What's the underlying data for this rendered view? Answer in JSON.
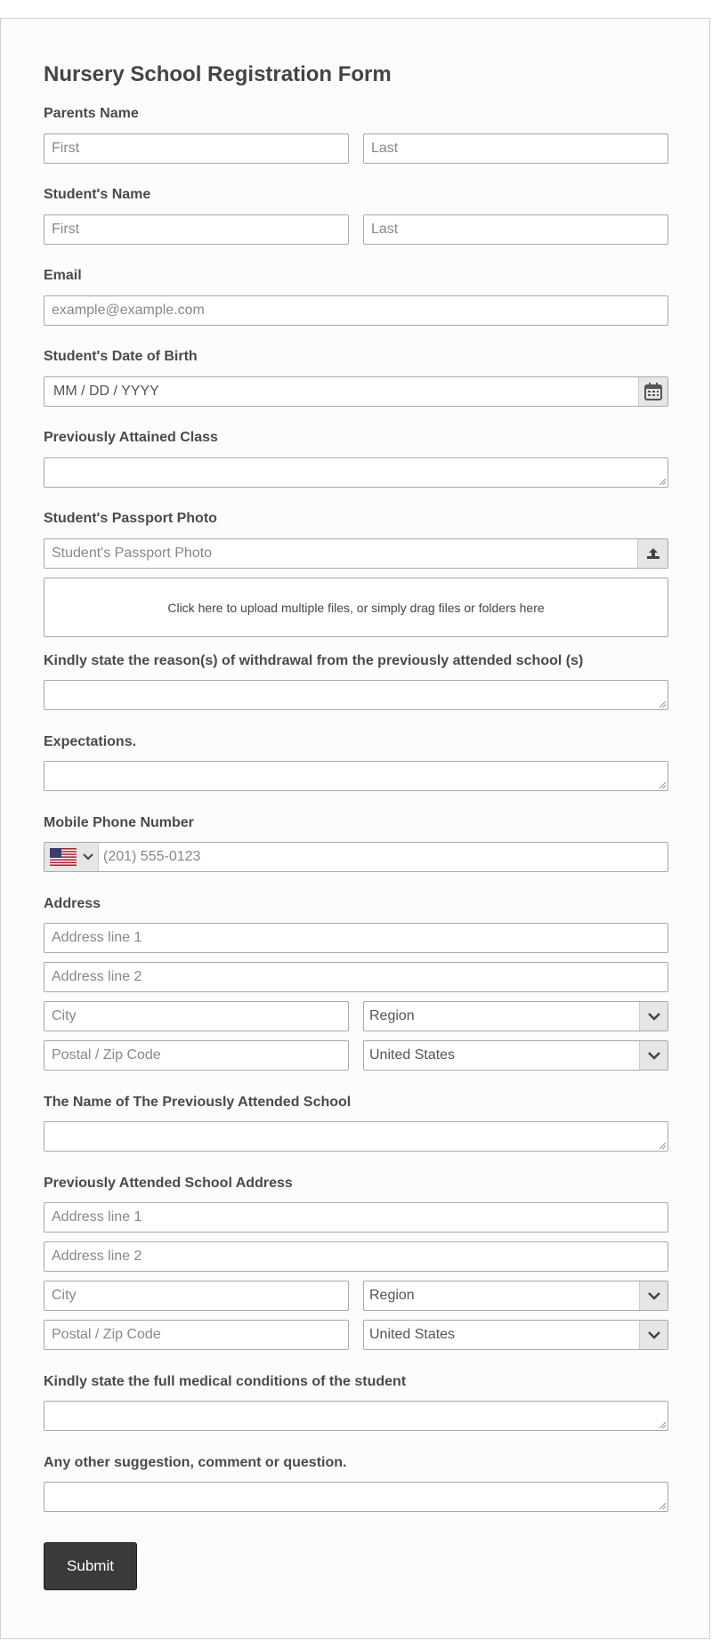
{
  "form": {
    "title": "Nursery School Registration Form",
    "parents_name": {
      "label": "Parents Name",
      "first": "First",
      "last": "Last"
    },
    "students_name": {
      "label": "Student's Name",
      "first": "First",
      "last": "Last"
    },
    "email": {
      "label": "Email",
      "placeholder": "example@example.com"
    },
    "dob": {
      "label": "Student's Date of Birth",
      "placeholder": "MM / DD / YYYY"
    },
    "previous_class": {
      "label": "Previously Attained Class"
    },
    "passport_photo": {
      "label": "Student's Passport Photo",
      "placeholder": "Student's Passport Photo",
      "dropzone_text": "Click here to upload multiple files, or simply drag files or folders here"
    },
    "withdrawal_reason": {
      "label": "Kindly state the reason(s) of withdrawal from the previously attended school (s)"
    },
    "expectations": {
      "label": "Expectations."
    },
    "phone": {
      "label": "Mobile Phone Number",
      "placeholder": "(201) 555-0123",
      "country_icon": "us-flag-icon"
    },
    "address": {
      "label": "Address",
      "line1": "Address line 1",
      "line2": "Address line 2",
      "city": "City",
      "region": "Region",
      "postal": "Postal / Zip Code",
      "country": "United States"
    },
    "prev_school_name": {
      "label": "The Name of The Previously Attended School"
    },
    "prev_school_address": {
      "label": "Previously Attended School Address",
      "line1": "Address line 1",
      "line2": "Address line 2",
      "city": "City",
      "region": "Region",
      "postal": "Postal / Zip Code",
      "country": "United States"
    },
    "medical": {
      "label": "Kindly state the full medical conditions of the student"
    },
    "comments": {
      "label": "Any other suggestion, comment or question."
    },
    "submit_label": "Submit"
  },
  "colors": {
    "submit_bg": "#3a3a3a",
    "border": "#a9a9a9"
  }
}
